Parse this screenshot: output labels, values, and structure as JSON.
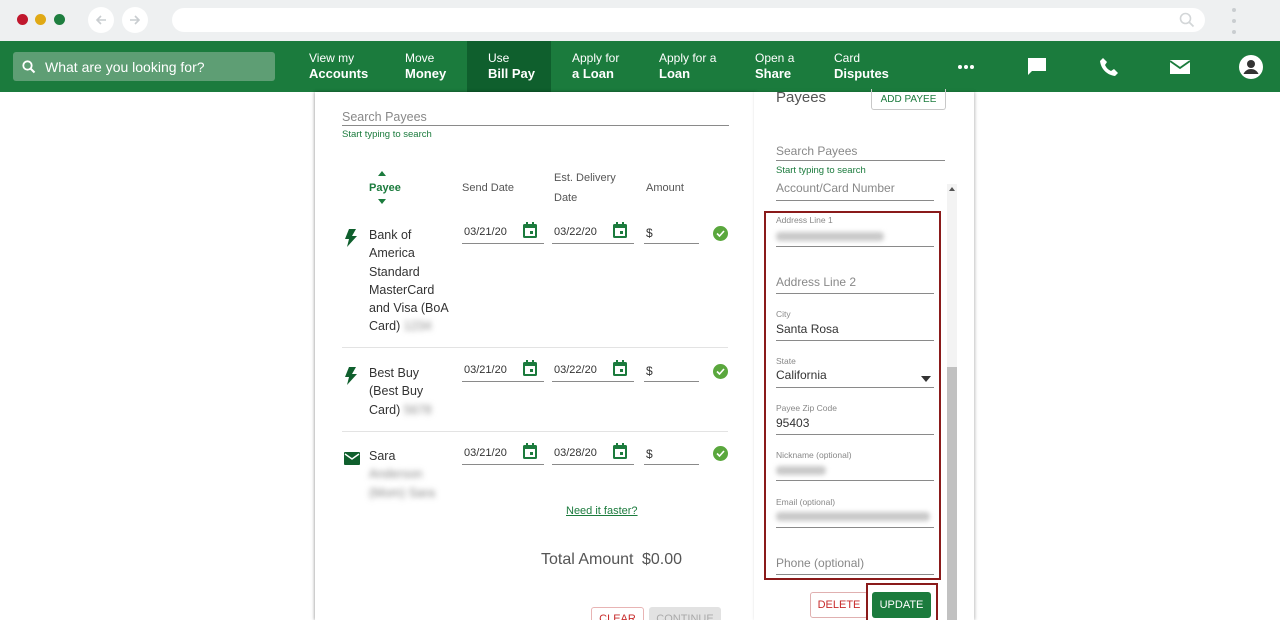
{
  "browser": {
    "back_icon": "arrow-left-icon",
    "forward_icon": "arrow-right-icon",
    "url": ""
  },
  "topnav": {
    "search_placeholder": "What are you looking for?",
    "items": [
      {
        "line1": "View my",
        "line2": "Accounts"
      },
      {
        "line1": "Move",
        "line2": "Money"
      },
      {
        "line1": "Use",
        "line2": "Bill Pay"
      },
      {
        "line1": "Apply for",
        "line2": "a Loan"
      },
      {
        "line1": "Apply for a",
        "line2": "Loan"
      },
      {
        "line1": "Open a",
        "line2": "Share"
      },
      {
        "line1": "Card",
        "line2": "Disputes"
      }
    ],
    "active_item": "Use Bill Pay",
    "colors": {
      "bar": "#1b7b3d",
      "active": "#0f5f2d",
      "search": "#5e9e74"
    }
  },
  "payments": {
    "search_placeholder": "Search Payees",
    "search_hint": "Start typing to search",
    "columns": {
      "payee": "Payee",
      "send_date": "Send Date",
      "est_line1": "Est. Delivery",
      "est_line2": "Date",
      "amount": "Amount"
    },
    "rows": [
      {
        "name": "Bank of America Standard MasterCard and Visa (BoA Card)",
        "send": "03/21/20",
        "delivery": "03/22/20",
        "amount": "$",
        "icon": "lightning-bolt-icon"
      },
      {
        "name": "Best Buy (Best Buy Card)",
        "send": "03/21/20",
        "delivery": "03/22/20",
        "amount": "$",
        "icon": "lightning-bolt-icon"
      },
      {
        "name": "Sara",
        "send": "03/21/20",
        "delivery": "03/28/20",
        "amount": "$",
        "icon": "envelope-icon"
      }
    ],
    "need_faster": "Need it faster?",
    "total_label": "Total Amount",
    "total_value": "$0.00",
    "clear_label": "CLEAR",
    "continue_label": "CONTINUE"
  },
  "payees_panel": {
    "title": "Payees",
    "add_label": "ADD PAYEE",
    "search_placeholder": "Search Payees",
    "search_hint": "Start typing to search",
    "account_placeholder": "Account/Card Number",
    "address1_label": "Address Line 1",
    "address2_placeholder": "Address Line 2",
    "city_label": "City",
    "city_value": "Santa Rosa",
    "state_label": "State",
    "state_value": "California",
    "zip_label": "Payee Zip Code",
    "zip_value": "95403",
    "nickname_label": "Nickname (optional)",
    "email_label": "Email (optional)",
    "phone_placeholder": "Phone (optional)",
    "delete_label": "DELETE",
    "update_label": "UPDATE",
    "highlight_color": "#8a1a1a"
  }
}
